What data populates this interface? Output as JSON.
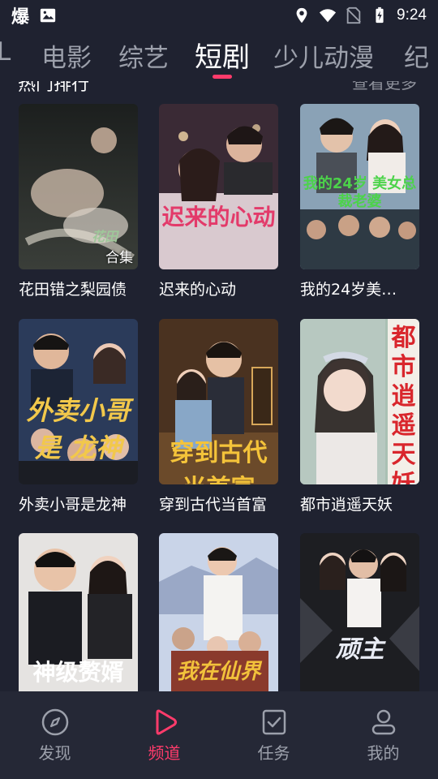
{
  "status_bar": {
    "app_glyph": "爆",
    "time": "9:24",
    "icons": [
      "image-icon",
      "location-icon",
      "wifi-icon",
      "no-sim-icon",
      "battery-charging-icon"
    ]
  },
  "tabs": {
    "items": [
      {
        "label": "L"
      },
      {
        "label": "电影"
      },
      {
        "label": "综艺"
      },
      {
        "label": "短剧",
        "active": true
      },
      {
        "label": "少儿动漫"
      },
      {
        "label": "纪"
      }
    ]
  },
  "section": {
    "title": "热门排行",
    "more": "查看更多"
  },
  "cards": [
    {
      "title": "花田错之梨园债",
      "badge": "合集",
      "poster_text": "花田"
    },
    {
      "title": "迟来的心动",
      "poster_text": "迟来的心动"
    },
    {
      "title": "我的24岁美…",
      "poster_text": "我的24岁 美女总裁老婆"
    },
    {
      "title": "外卖小哥是龙神",
      "poster_text": "外卖小哥是 龙神"
    },
    {
      "title": "穿到古代当首富",
      "poster_text": "穿到古代 当首富"
    },
    {
      "title": "都市逍遥天妖",
      "poster_text": "都市逍遥天妖"
    },
    {
      "title": "",
      "poster_text": "神级赘婿"
    },
    {
      "title": "",
      "poster_text": "我在仙界"
    },
    {
      "title": "",
      "poster_text": "顽主"
    }
  ],
  "bottom_nav": {
    "items": [
      {
        "label": "发现",
        "icon": "compass-icon"
      },
      {
        "label": "频道",
        "icon": "play-icon",
        "active": true
      },
      {
        "label": "任务",
        "icon": "task-icon"
      },
      {
        "label": "我的",
        "icon": "profile-icon"
      }
    ]
  },
  "colors": {
    "background": "#1f2230",
    "accent": "#ff3b6b",
    "nav_background": "#252836",
    "inactive_text": "#9ca0ab"
  }
}
